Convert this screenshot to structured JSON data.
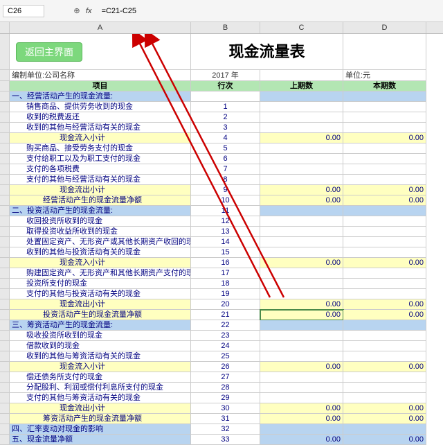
{
  "formula_bar": {
    "cell_ref": "C26",
    "fx_label": "fx",
    "formula": "=C21-C25"
  },
  "columns": [
    "",
    "A",
    "B",
    "C",
    "D"
  ],
  "button": {
    "return_label": "返回主界面"
  },
  "title": "现金流量表",
  "info": {
    "left": "编制单位:公司名称",
    "center": "2017 年",
    "right": "单位:元"
  },
  "headers": {
    "item": "项目",
    "line": "行次",
    "prev": "上期数",
    "curr": "本期数"
  },
  "rows": [
    {
      "type": "blue",
      "label": "一、经营活动产生的现金流量:",
      "line": "",
      "prev": "",
      "curr": ""
    },
    {
      "type": "white",
      "indent": 1,
      "label": "销售商品、提供劳务收到的现金",
      "line": "1",
      "prev": "",
      "curr": ""
    },
    {
      "type": "white",
      "indent": 1,
      "label": "收到的税费返还",
      "line": "2",
      "prev": "",
      "curr": ""
    },
    {
      "type": "white",
      "indent": 1,
      "label": "收到的其他与经营活动有关的现金",
      "line": "3",
      "prev": "",
      "curr": ""
    },
    {
      "type": "yellow",
      "indent": 3,
      "label": "现金流入小计",
      "line": "4",
      "prev": "0.00",
      "curr": "0.00"
    },
    {
      "type": "white",
      "indent": 1,
      "label": "购买商品、接受劳务支付的现金",
      "line": "5",
      "prev": "",
      "curr": ""
    },
    {
      "type": "white",
      "indent": 1,
      "label": "支付给职工以及为职工支付的现金",
      "line": "6",
      "prev": "",
      "curr": ""
    },
    {
      "type": "white",
      "indent": 1,
      "label": "支付的各项税费",
      "line": "7",
      "prev": "",
      "curr": ""
    },
    {
      "type": "white",
      "indent": 1,
      "label": "支付的其他与经营活动有关的现金",
      "line": "8",
      "prev": "",
      "curr": ""
    },
    {
      "type": "yellow",
      "indent": 3,
      "label": "现金流出小计",
      "line": "9",
      "prev": "0.00",
      "curr": "0.00"
    },
    {
      "type": "yellow",
      "indent": 2,
      "label": "经营活动产生的现金流量净额",
      "line": "10",
      "prev": "0.00",
      "curr": "0.00"
    },
    {
      "type": "blue",
      "label": "二、投资活动产生的现金流量:",
      "line": "11",
      "prev": "",
      "curr": ""
    },
    {
      "type": "white",
      "indent": 1,
      "label": "收回投资所收到的现金",
      "line": "12",
      "prev": "",
      "curr": ""
    },
    {
      "type": "white",
      "indent": 1,
      "label": "取得投资收益所收到的现金",
      "line": "13",
      "prev": "",
      "curr": ""
    },
    {
      "type": "white",
      "indent": 1,
      "label": "处置固定资产、无形资产或其他长期资产收回的现金净",
      "line": "14",
      "prev": "",
      "curr": ""
    },
    {
      "type": "white",
      "indent": 1,
      "label": "收到的其他与投资活动有关的现金",
      "line": "15",
      "prev": "",
      "curr": ""
    },
    {
      "type": "yellow",
      "indent": 3,
      "label": "现金流入小计",
      "line": "16",
      "prev": "0.00",
      "curr": "0.00"
    },
    {
      "type": "white",
      "indent": 1,
      "label": "购建固定资产、无形资产和其他长期资产支付的现金",
      "line": "17",
      "prev": "",
      "curr": ""
    },
    {
      "type": "white",
      "indent": 1,
      "label": "投资所支付的现金",
      "line": "18",
      "prev": "",
      "curr": ""
    },
    {
      "type": "white",
      "indent": 1,
      "label": "支付的其他与投资活动有关的现金",
      "line": "19",
      "prev": "",
      "curr": ""
    },
    {
      "type": "yellow",
      "indent": 3,
      "label": "现金流出小计",
      "line": "20",
      "prev": "0.00",
      "curr": "0.00"
    },
    {
      "type": "yellow",
      "indent": 2,
      "selected": true,
      "label": "投资活动产生的现金流量净额",
      "line": "21",
      "prev": "0.00",
      "curr": "0.00"
    },
    {
      "type": "blue",
      "label": "三、筹资活动产生的现金流量:",
      "line": "22",
      "prev": "",
      "curr": ""
    },
    {
      "type": "white",
      "indent": 1,
      "label": "吸收投资所收到的现金",
      "line": "23",
      "prev": "",
      "curr": ""
    },
    {
      "type": "white",
      "indent": 1,
      "label": "借款收到的现金",
      "line": "24",
      "prev": "",
      "curr": ""
    },
    {
      "type": "white",
      "indent": 1,
      "label": "收到的其他与筹资活动有关的现金",
      "line": "25",
      "prev": "",
      "curr": ""
    },
    {
      "type": "yellow",
      "indent": 3,
      "label": "现金流入小计",
      "line": "26",
      "prev": "0.00",
      "curr": "0.00"
    },
    {
      "type": "white",
      "indent": 1,
      "label": "偿还债务所支付的现金",
      "line": "27",
      "prev": "",
      "curr": ""
    },
    {
      "type": "white",
      "indent": 1,
      "label": "分配股利、利润或偿付利息所支付的现金",
      "line": "28",
      "prev": "",
      "curr": ""
    },
    {
      "type": "white",
      "indent": 1,
      "label": "支付的其他与筹资活动有关的现金",
      "line": "29",
      "prev": "",
      "curr": ""
    },
    {
      "type": "yellow",
      "indent": 3,
      "label": "现金流出小计",
      "line": "30",
      "prev": "0.00",
      "curr": "0.00"
    },
    {
      "type": "yellow",
      "indent": 2,
      "label": "筹资活动产生的现金流量净额",
      "line": "31",
      "prev": "0.00",
      "curr": "0.00"
    },
    {
      "type": "blue",
      "label": "四、汇率变动对现金的影响",
      "line": "32",
      "prev": "",
      "curr": ""
    },
    {
      "type": "blue",
      "label": "五、现金流量净额",
      "line": "33",
      "prev": "0.00",
      "curr": "0.00"
    }
  ]
}
